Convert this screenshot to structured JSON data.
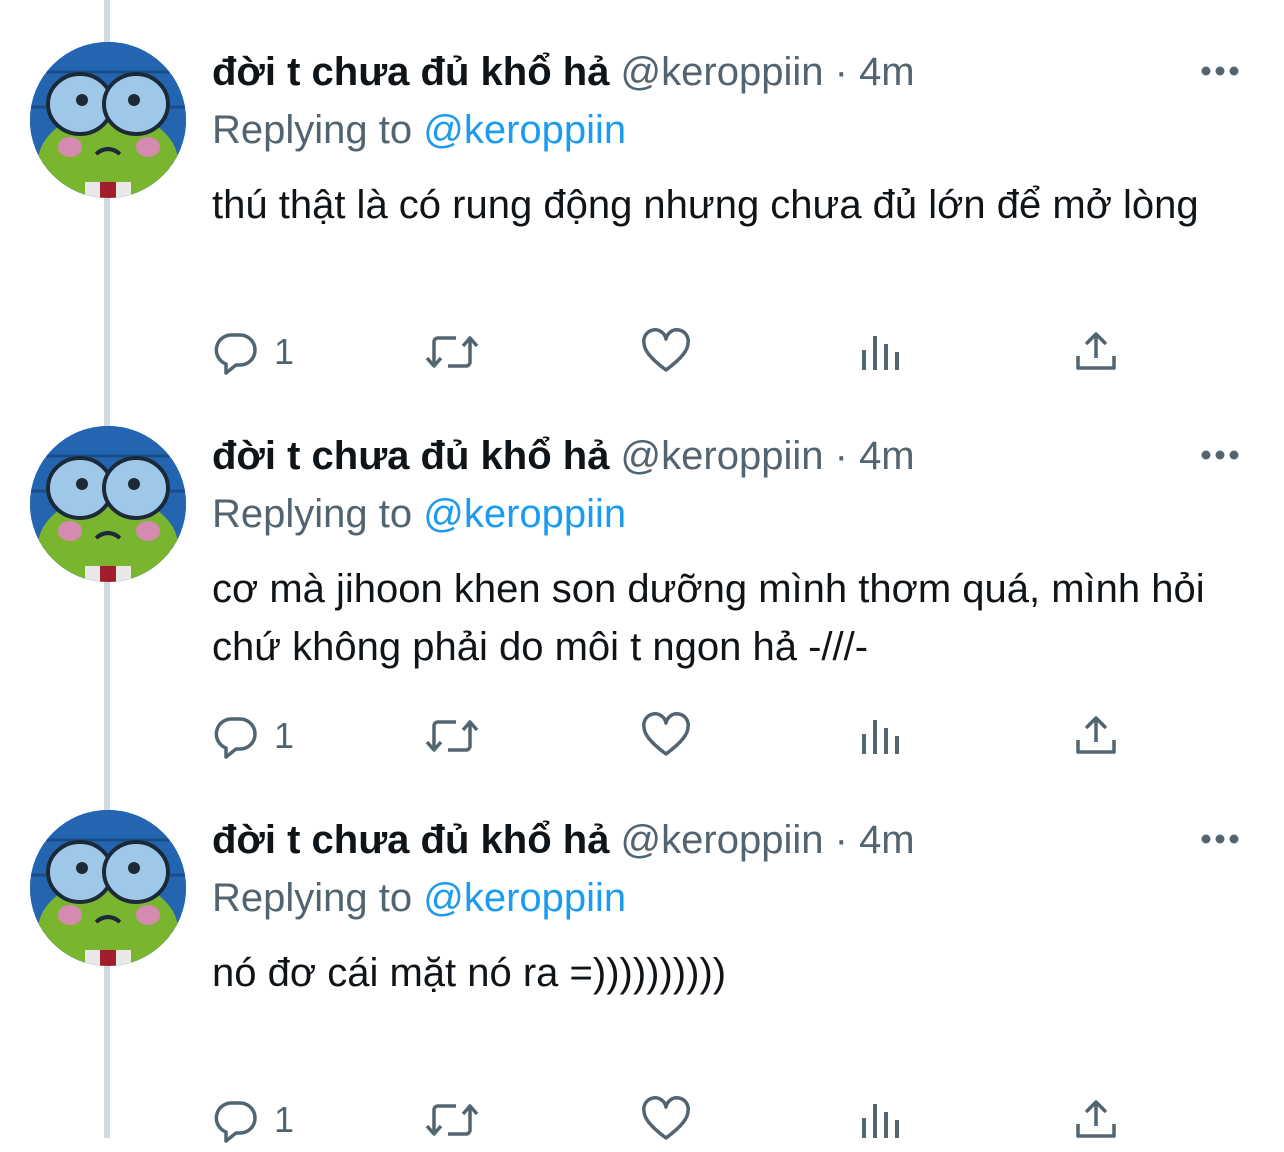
{
  "tweets": [
    {
      "name": "đời t chưa đủ khổ hả",
      "handle": "@keroppiin",
      "separator": "·",
      "time": "4m",
      "replying_prefix": "Replying to",
      "replying_to": "@keroppiin",
      "text": "thú thật là có rung động nhưng chưa đủ lớn để mở lòng",
      "reply_count": "1"
    },
    {
      "name": "đời t chưa đủ khổ hả",
      "handle": "@keroppiin",
      "separator": "·",
      "time": "4m",
      "replying_prefix": "Replying to",
      "replying_to": "@keroppiin",
      "text": "cơ mà jihoon khen son dưỡng mình thơm quá, mình hỏi chứ không phải do môi t ngon hả -///-",
      "reply_count": "1"
    },
    {
      "name": "đời t chưa đủ khổ hả",
      "handle": "@keroppiin",
      "separator": "·",
      "time": "4m",
      "replying_prefix": "Replying to",
      "replying_to": "@keroppiin",
      "text": "nó đơ cái mặt nó ra =))))))))))",
      "reply_count": "1"
    }
  ],
  "icons": {
    "more": "more-horizontal-icon",
    "reply": "reply-bubble-icon",
    "retweet": "retweet-icon",
    "like": "heart-icon",
    "views": "analytics-icon",
    "share": "share-upload-icon"
  },
  "colors": {
    "text": "#0f1419",
    "secondary": "#536471",
    "link": "#1d9bf0",
    "thread_line": "#cfd9de"
  }
}
